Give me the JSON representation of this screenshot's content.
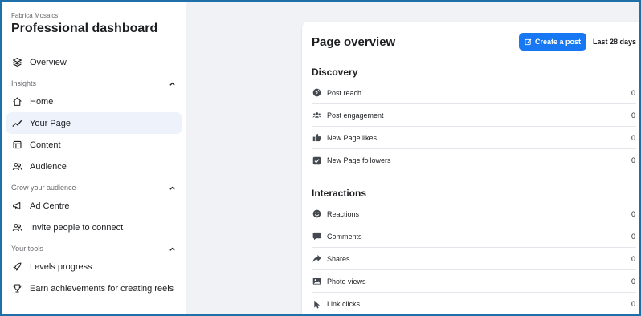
{
  "sidebar": {
    "org_name": "Fabrica Mosaics",
    "title": "Professional dashboard",
    "overview": {
      "label": "Overview",
      "icon": "overview-icon"
    },
    "sections": [
      {
        "heading": "Insights",
        "items": [
          {
            "label": "Home",
            "icon": "home-icon"
          },
          {
            "label": "Your Page",
            "icon": "trend-icon",
            "active": true
          },
          {
            "label": "Content",
            "icon": "content-icon"
          },
          {
            "label": "Audience",
            "icon": "audience-icon"
          }
        ]
      },
      {
        "heading": "Grow your audience",
        "items": [
          {
            "label": "Ad Centre",
            "icon": "megaphone-icon"
          },
          {
            "label": "Invite people to connect",
            "icon": "invite-people-icon"
          }
        ]
      },
      {
        "heading": "Your tools",
        "items": [
          {
            "label": "Levels progress",
            "icon": "rocket-icon"
          },
          {
            "label": "Earn achievements for creating reels",
            "icon": "trophy-icon"
          }
        ]
      }
    ]
  },
  "card": {
    "title": "Page overview",
    "create_button": "Create a post",
    "date_range": "Last 28 days",
    "groups": [
      {
        "title": "Discovery",
        "metrics": [
          {
            "label": "Post reach",
            "value": "0",
            "icon": "globe-icon"
          },
          {
            "label": "Post engagement",
            "value": "0",
            "icon": "people-icon"
          },
          {
            "label": "New Page likes",
            "value": "0",
            "icon": "thumbs-up-icon"
          },
          {
            "label": "New Page followers",
            "value": "0",
            "icon": "follow-check-icon"
          }
        ]
      },
      {
        "title": "Interactions",
        "metrics": [
          {
            "label": "Reactions",
            "value": "0",
            "icon": "reaction-face-icon"
          },
          {
            "label": "Comments",
            "value": "0",
            "icon": "comment-icon"
          },
          {
            "label": "Shares",
            "value": "0",
            "icon": "share-icon"
          },
          {
            "label": "Photo views",
            "value": "0",
            "icon": "photo-icon"
          },
          {
            "label": "Link clicks",
            "value": "0",
            "icon": "cursor-icon"
          }
        ]
      }
    ]
  },
  "colors": {
    "accent": "#1877f2",
    "frame_border": "#1f6fa8",
    "active_bg": "#eef3fb",
    "page_bg": "#f0f2f5"
  }
}
